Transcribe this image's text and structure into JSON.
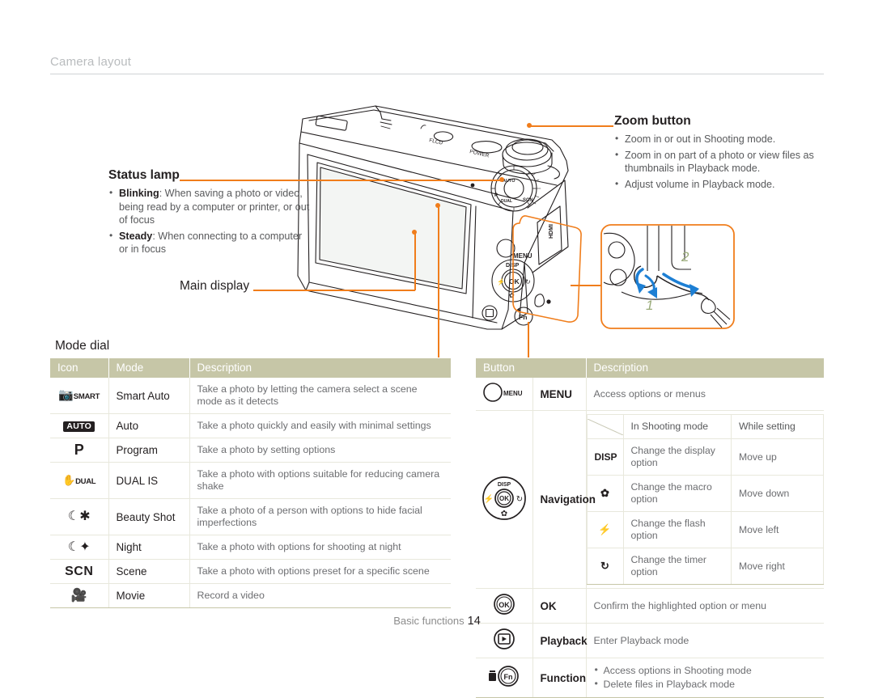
{
  "header": {
    "title": "Camera layout"
  },
  "callouts": {
    "zoom_button": {
      "title": "Zoom button",
      "items": [
        "Zoom in or out in Shooting mode.",
        "Zoom in on part of a photo or view files as thumbnails in Playback mode.",
        "Adjust volume in Playback mode."
      ]
    },
    "status_lamp": {
      "title": "Status lamp",
      "items": [
        {
          "lead": "Blinking",
          "text": ": When saving a photo or video, being read by a computer or printer, or out of focus"
        },
        {
          "lead": "Steady",
          "text": ": When connecting to a computer or in focus"
        }
      ]
    },
    "main_display": "Main display",
    "mode_dial": "Mode dial"
  },
  "illustration": {
    "top_labels": [
      "FLCD",
      "POWER"
    ],
    "inset_steps": [
      "1",
      "2"
    ],
    "camera_buttons": [
      "MENU",
      "DISP",
      "OK",
      "Fn"
    ],
    "side_port": "HDMI"
  },
  "mode_dial_table": {
    "headers": [
      "Icon",
      "Mode",
      "Description"
    ],
    "rows": [
      {
        "icon": "smart-auto-icon",
        "icon_text": "SMART",
        "mode": "Smart Auto",
        "description": "Take a photo by letting the camera select a scene mode as it detects"
      },
      {
        "icon": "auto-icon",
        "icon_text": "AUTO",
        "mode": "Auto",
        "description": "Take a photo quickly and easily with minimal settings"
      },
      {
        "icon": "program-icon",
        "icon_text": "P",
        "mode": "Program",
        "description": "Take a photo by setting options"
      },
      {
        "icon": "dual-is-icon",
        "icon_text": "DUAL",
        "mode": "DUAL IS",
        "description": "Take a photo with options suitable for reducing camera shake"
      },
      {
        "icon": "beauty-shot-icon",
        "icon_text": "",
        "mode": "Beauty Shot",
        "description": "Take a photo of a person with options to hide facial imperfections"
      },
      {
        "icon": "night-icon",
        "icon_text": "",
        "mode": "Night",
        "description": "Take a photo with options for shooting at night"
      },
      {
        "icon": "scene-icon",
        "icon_text": "SCN",
        "mode": "Scene",
        "description": "Take a photo with options preset for a specific scene"
      },
      {
        "icon": "movie-icon",
        "icon_text": "",
        "mode": "Movie",
        "description": "Record a video"
      }
    ]
  },
  "button_table": {
    "headers": [
      "Button",
      "Description"
    ],
    "rows": {
      "menu": {
        "icon": "menu-button-icon",
        "icon_text": "MENU",
        "name": "MENU",
        "description": "Access options or menus"
      },
      "navigation": {
        "icon": "navigation-pad-icon",
        "name": "Navigation",
        "sub_headers": [
          "",
          "In Shooting mode",
          "While setting"
        ],
        "sub_rows": [
          {
            "key": "DISP",
            "shooting": "Change the display option",
            "setting": "Move up"
          },
          {
            "key": "macro",
            "shooting": "Change the macro option",
            "setting": "Move down"
          },
          {
            "key": "flash",
            "shooting": "Change the flash option",
            "setting": "Move left"
          },
          {
            "key": "timer",
            "shooting": "Change the timer option",
            "setting": "Move right"
          }
        ]
      },
      "ok": {
        "icon": "ok-button-icon",
        "name": "OK",
        "description": "Confirm the highlighted option or menu"
      },
      "playback": {
        "icon": "playback-button-icon",
        "name": "Playback",
        "description": "Enter Playback mode"
      },
      "function": {
        "icon": "function-button-icon",
        "name": "Function",
        "items": [
          "Access options in Shooting mode",
          "Delete files in Playback mode"
        ]
      }
    }
  },
  "footer": {
    "section": "Basic functions",
    "page": "14"
  },
  "colors": {
    "accent_orange": "#f07d1b",
    "table_header_bg": "#c6c6a7",
    "title_gray": "#b9bcbe",
    "body_gray": "#6d6e71"
  }
}
